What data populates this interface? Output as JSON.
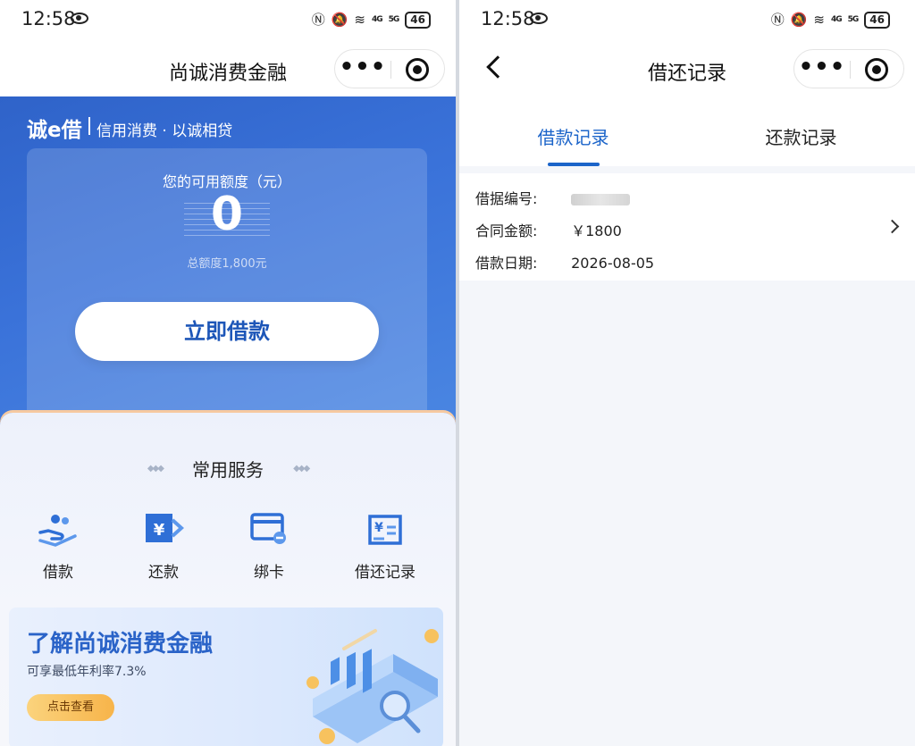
{
  "status_bar": {
    "time": "12:58",
    "network_4g": "4G",
    "network_5g": "5G",
    "battery": "46"
  },
  "left_screen": {
    "header": {
      "title": "尚诚消费金融"
    },
    "banner": {
      "brand": "诚e借",
      "slogan": "信用消费 · 以诚相贷",
      "credit_label": "您的可用额度（元）",
      "credit_value": "0",
      "credit_total": "总额度1,800元",
      "borrow_button": "立即借款"
    },
    "services": {
      "title": "常用服务",
      "items": [
        {
          "label": "借款",
          "icon": "hand-coins-icon"
        },
        {
          "label": "还款",
          "icon": "repay-arrow-icon"
        },
        {
          "label": "绑卡",
          "icon": "bind-card-icon"
        },
        {
          "label": "借还记录",
          "icon": "record-ledger-icon"
        }
      ]
    },
    "promo": {
      "title": "了解尚诚消费金融",
      "subtitle": "可享最低年利率7.3%",
      "button": "点击查看"
    }
  },
  "right_screen": {
    "header": {
      "title": "借还记录"
    },
    "tabs": [
      {
        "label": "借款记录",
        "active": true
      },
      {
        "label": "还款记录",
        "active": false
      }
    ],
    "record": {
      "receipt_label": "借据编号:",
      "amount_label": "合同金额:",
      "amount_value": "￥1800",
      "date_label": "借款日期:",
      "date_value": "2026-08-05"
    }
  },
  "colors": {
    "accent_blue": "#1b64c9",
    "banner_blue": "#3a72d9",
    "promo_gold": "#f7b44a"
  }
}
